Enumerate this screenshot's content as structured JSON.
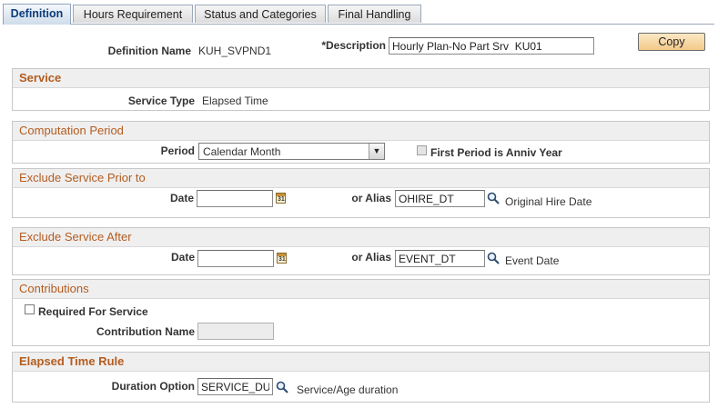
{
  "tabs": [
    {
      "label": "Definition",
      "active": true
    },
    {
      "label": "Hours Requirement",
      "active": false
    },
    {
      "label": "Status and Categories",
      "active": false
    },
    {
      "label": "Final Handling",
      "active": false
    }
  ],
  "header": {
    "definition_name_label": "Definition Name",
    "definition_name_value": "KUH_SVPND1",
    "description_label": "*Description",
    "description_value": "Hourly Plan-No Part Srv  KU01",
    "copy_button": "Copy"
  },
  "service": {
    "title": "Service",
    "service_type_label": "Service Type",
    "service_type_value": "Elapsed Time"
  },
  "computation_period": {
    "title": "Computation Period",
    "period_label": "Period",
    "period_value": "Calendar Month",
    "first_period_label": "First Period is Anniv Year",
    "first_period_checked": false
  },
  "exclude_prior": {
    "title": "Exclude Service Prior to",
    "date_label": "Date",
    "date_value": "",
    "alias_label": "or Alias",
    "alias_value": "OHIRE_DT",
    "alias_desc": "Original Hire Date"
  },
  "exclude_after": {
    "title": "Exclude Service After",
    "date_label": "Date",
    "date_value": "",
    "alias_label": "or Alias",
    "alias_value": "EVENT_DT",
    "alias_desc": "Event Date"
  },
  "contributions": {
    "title": "Contributions",
    "required_label": "Required For Service",
    "required_checked": false,
    "contribution_name_label": "Contribution Name",
    "contribution_name_value": ""
  },
  "elapsed_time_rule": {
    "title": "Elapsed Time Rule",
    "duration_label": "Duration Option",
    "duration_value": "SERVICE_DU",
    "duration_desc": "Service/Age duration"
  },
  "icons": {
    "calendar": "calendar-icon",
    "lookup": "lookup-icon",
    "dropdown": "chevron-down-icon"
  },
  "colors": {
    "section_title": "#b45c1f",
    "copy_button": "#f3c98a",
    "active_tab_text": "#0c3c7a"
  }
}
